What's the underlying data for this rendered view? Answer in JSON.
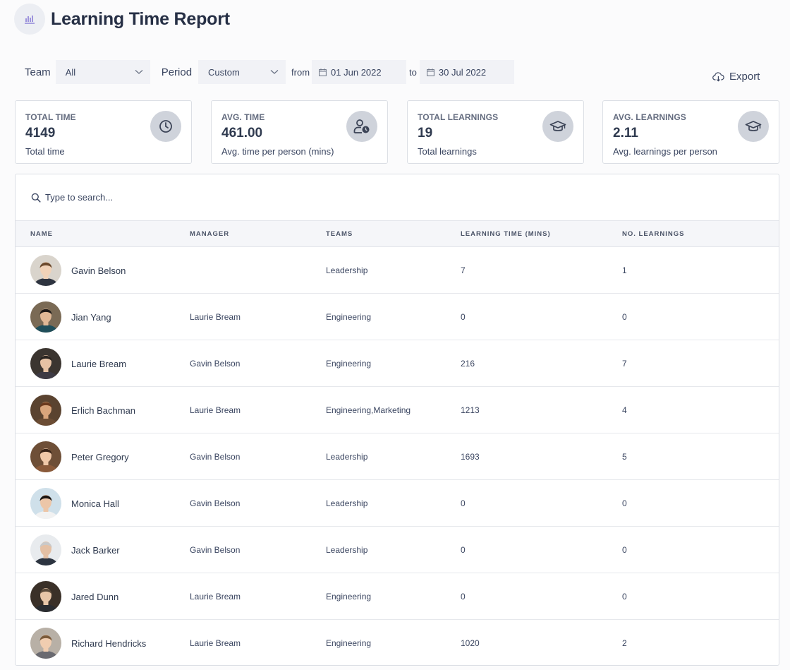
{
  "header": {
    "title": "Learning Time Report",
    "icon": "bar-chart-icon"
  },
  "filters": {
    "team_label": "Team",
    "team_value": "All",
    "period_label": "Period",
    "period_value": "Custom",
    "from_label": "from",
    "from_date": "01 Jun 2022",
    "to_label": "to",
    "to_date": "30 Jul 2022"
  },
  "export": {
    "label": "Export",
    "icon": "cloud-download-icon"
  },
  "stats": [
    {
      "title": "TOTAL TIME",
      "value": "4149",
      "subtitle": "Total time",
      "icon": "clock-icon"
    },
    {
      "title": "AVG. TIME",
      "value": "461.00",
      "subtitle": "Avg. time per person (mins)",
      "icon": "user-clock-icon"
    },
    {
      "title": "TOTAL LEARNINGS",
      "value": "19",
      "subtitle": "Total learnings",
      "icon": "graduation-cap-icon"
    },
    {
      "title": "AVG. LEARNINGS",
      "value": "2.11",
      "subtitle": "Avg. learnings per person",
      "icon": "graduation-cap-icon"
    }
  ],
  "search": {
    "placeholder": "Type to search..."
  },
  "table": {
    "columns": [
      "NAME",
      "MANAGER",
      "TEAMS",
      "LEARNING TIME (MINS)",
      "NO. LEARNINGS"
    ],
    "rows": [
      {
        "name": "Gavin Belson",
        "manager": "",
        "teams": "Leadership",
        "time": "7",
        "learnings": "1",
        "avatar_colors": [
          "#d9d4cc",
          "#f0d2b8",
          "#6b4a2e",
          "#2e3440"
        ]
      },
      {
        "name": "Jian Yang",
        "manager": "Laurie Bream",
        "teams": "Engineering",
        "time": "0",
        "learnings": "0",
        "avatar_colors": [
          "#7a6a55",
          "#e0b896",
          "#1e1a18",
          "#1f4e5a"
        ]
      },
      {
        "name": "Laurie Bream",
        "manager": "Gavin Belson",
        "teams": "Engineering",
        "time": "216",
        "learnings": "7",
        "avatar_colors": [
          "#3b3530",
          "#e6c2a4",
          "#2a2420",
          "#3d3a44"
        ]
      },
      {
        "name": "Erlich Bachman",
        "manager": "Laurie Bream",
        "teams": "Engineering,Marketing",
        "time": "1213",
        "learnings": "4",
        "avatar_colors": [
          "#5a4330",
          "#d9a57c",
          "#6b3a1e",
          "#6b4c34"
        ]
      },
      {
        "name": "Peter Gregory",
        "manager": "Gavin Belson",
        "teams": "Leadership",
        "time": "1693",
        "learnings": "5",
        "avatar_colors": [
          "#6e4f37",
          "#f0c8a8",
          "#3a2518",
          "#8a5a3a"
        ]
      },
      {
        "name": "Monica Hall",
        "manager": "Gavin Belson",
        "teams": "Leadership",
        "time": "0",
        "learnings": "0",
        "avatar_colors": [
          "#cfe0ea",
          "#ecc6a8",
          "#1a1512",
          "#f2f2f2"
        ]
      },
      {
        "name": "Jack Barker",
        "manager": "Gavin Belson",
        "teams": "Leadership",
        "time": "0",
        "learnings": "0",
        "avatar_colors": [
          "#e8ebee",
          "#e4c0a4",
          "#c9c9c9",
          "#2c3440"
        ]
      },
      {
        "name": "Jared Dunn",
        "manager": "Laurie Bream",
        "teams": "Engineering",
        "time": "0",
        "learnings": "0",
        "avatar_colors": [
          "#3a3028",
          "#e8c6a8",
          "#5a4a3a",
          "#2a2c30"
        ]
      },
      {
        "name": "Richard Hendricks",
        "manager": "Laurie Bream",
        "teams": "Engineering",
        "time": "1020",
        "learnings": "2",
        "avatar_colors": [
          "#b8b0a6",
          "#f0cdb0",
          "#7a5a3a",
          "#6a6a70"
        ]
      }
    ]
  }
}
